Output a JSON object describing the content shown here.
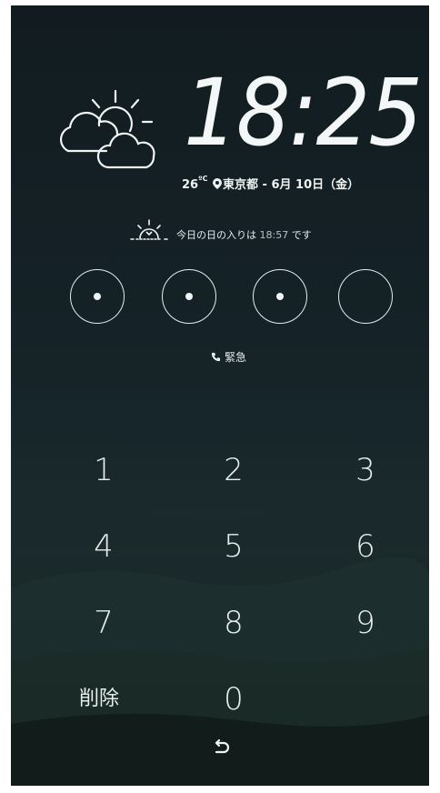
{
  "clock": {
    "time": "18:25"
  },
  "info": {
    "temperature": "26",
    "unit": "ºC",
    "location": "東京都",
    "separator": " - ",
    "date": "6月 10日（金）"
  },
  "sunset": {
    "prefix": "今日の日の入りは ",
    "time": "18:57",
    "suffix": " です"
  },
  "pin": {
    "entered": 3,
    "total": 4
  },
  "emergency": {
    "label": "緊急"
  },
  "keypad": {
    "keys": [
      "1",
      "2",
      "3",
      "4",
      "5",
      "6",
      "7",
      "8",
      "9"
    ],
    "delete_label": "削除",
    "zero": "0"
  },
  "icons": {
    "weather": "partly-cloudy-icon",
    "sunset": "sunset-icon",
    "phone": "phone-icon",
    "location": "location-pin-icon",
    "back": "back-icon"
  },
  "colors": {
    "background": "#142126",
    "foreground": "#eef2f2"
  }
}
